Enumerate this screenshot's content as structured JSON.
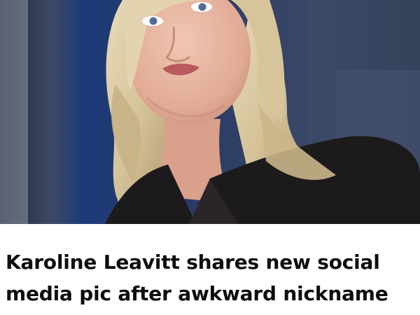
{
  "article": {
    "headline": "Karoline Leavitt shares new social media pic after awkward nickname",
    "image": {
      "icon": "portrait-photo",
      "colors": {
        "background_left": "#1f2a40",
        "background_right": "#36435e",
        "curtain_blue": "#1d3a78",
        "hair": "#d9c8a2",
        "hair_shadow": "#b59f75",
        "skin": "#e8b9a5",
        "skin_shadow": "#c98e7a",
        "lips": "#b85a5e",
        "eyes": "#4f6f95",
        "jacket": "#1d1a1c"
      }
    }
  }
}
